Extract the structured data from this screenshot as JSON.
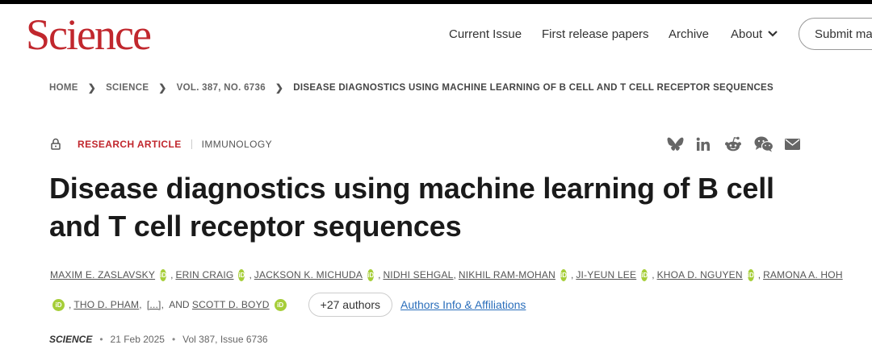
{
  "header": {
    "logo": "Science",
    "nav": {
      "current_issue": "Current Issue",
      "first_release": "First release papers",
      "archive": "Archive",
      "about": "About"
    },
    "submit_label": "Submit ma"
  },
  "breadcrumb": {
    "home": "HOME",
    "science": "SCIENCE",
    "volume": "VOL. 387, NO. 6736",
    "current": "DISEASE DIAGNOSTICS USING MACHINE LEARNING OF B CELL AND T CELL RECEPTOR SEQUENCES"
  },
  "article": {
    "type": "RESEARCH ARTICLE",
    "subject": "IMMUNOLOGY",
    "title": "Disease diagnostics using machine learning of B cell and T cell receptor sequences",
    "authors_line1": [
      {
        "name": "MAXIM E. ZASLAVSKY",
        "orcid": true
      },
      {
        "name": "ERIN CRAIG",
        "orcid": true
      },
      {
        "name": "JACKSON K. MICHUDA",
        "orcid": true
      },
      {
        "name": "NIDHI SEHGAL",
        "orcid": false
      },
      {
        "name": "NIKHIL RAM-MOHAN",
        "orcid": true
      },
      {
        "name": "JI-YEUN LEE",
        "orcid": true
      },
      {
        "name": "KHOA D. NGUYEN",
        "orcid": true
      },
      {
        "name": "RAMONA A. HOH",
        "orcid": false
      }
    ],
    "authors_line2": {
      "tho": "THO D. PHAM",
      "ellipsis": "[...]",
      "and": "AND",
      "boyd": "SCOTT D. BOYD"
    },
    "orcid_label": "iD",
    "more_authors": "+27 authors",
    "affiliations_link": "Authors Info & Affiliations",
    "journal": "SCIENCE",
    "date": "21 Feb 2025",
    "volume_issue": "Vol 387, Issue 6736"
  },
  "colors": {
    "brand_red": "#c1272d",
    "orcid_green": "#a6ce39",
    "link_blue": "#2a6ebb"
  },
  "share_icons": [
    "bluesky-icon",
    "linkedin-icon",
    "reddit-icon",
    "wechat-icon",
    "email-icon"
  ]
}
